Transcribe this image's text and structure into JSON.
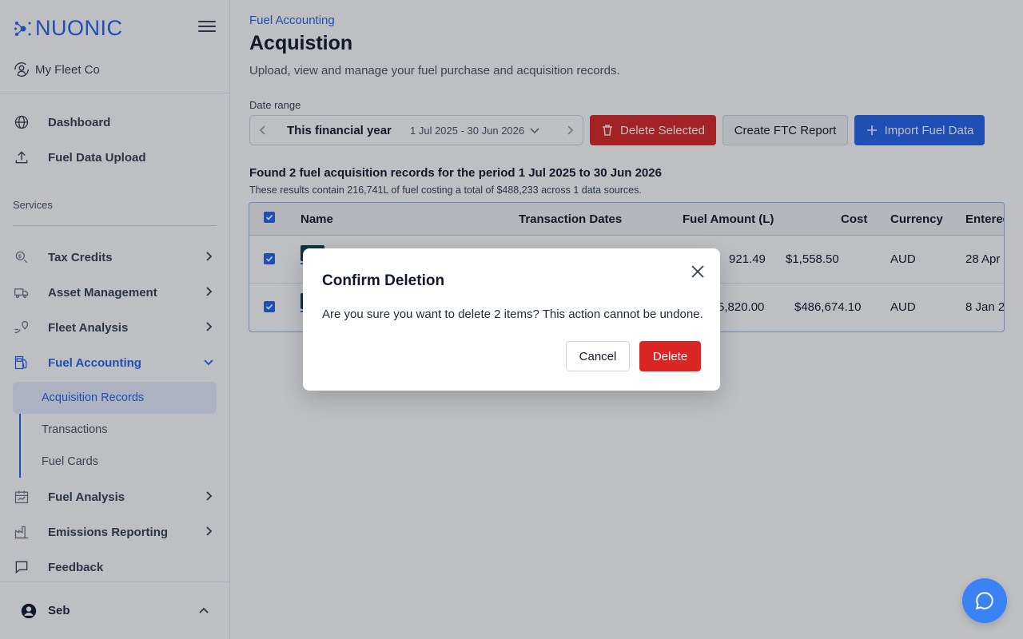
{
  "brand": {
    "name": "NUONIC",
    "color": "#2563eb"
  },
  "sidebar": {
    "org": "My Fleet Co",
    "top_items": [
      {
        "label": "Dashboard",
        "icon": "globe-icon"
      },
      {
        "label": "Fuel Data Upload",
        "icon": "upload-icon"
      }
    ],
    "section_label": "Services",
    "items": [
      {
        "label": "Tax Credits",
        "icon": "tax-credit-icon"
      },
      {
        "label": "Asset Management",
        "icon": "truck-icon"
      },
      {
        "label": "Fleet Analysis",
        "icon": "route-pin-icon"
      },
      {
        "label": "Fuel Accounting",
        "icon": "fuel-pump-icon",
        "expanded": true
      },
      {
        "label": "Fuel Analysis",
        "icon": "calendar-analysis-icon"
      },
      {
        "label": "Emissions Reporting",
        "icon": "factory-icon"
      },
      {
        "label": "Feedback",
        "icon": "chat-bubble-icon"
      }
    ],
    "sub_items": [
      {
        "label": "Acquisition Records",
        "active": true
      },
      {
        "label": "Transactions"
      },
      {
        "label": "Fuel Cards"
      }
    ],
    "user": "Seb"
  },
  "header": {
    "breadcrumb": "Fuel Accounting",
    "title": "Acquistion",
    "subtitle": "Upload, view and manage your fuel purchase and acquisition records."
  },
  "filters": {
    "date_range_label": "Date range",
    "range_name": "This financial year",
    "range_dates": "1 Jul 2025 - 30 Jun 2026"
  },
  "toolbar": {
    "delete_selected": "Delete Selected",
    "create_ftc": "Create FTC Report",
    "import": "Import Fuel Data"
  },
  "results": {
    "summary": "Found 2 fuel acquisition records for the period 1 Jul 2025 to 30 Jun 2026",
    "detail": "These results contain 216,741L of fuel costing a total of $488,233 across 1 data sources."
  },
  "table": {
    "columns": [
      "Name",
      "Transaction Dates",
      "Fuel Amount (L)",
      "Cost",
      "Currency",
      "Entered"
    ],
    "rows": [
      {
        "fuel_amount": "921.49",
        "cost": "$1,558.50",
        "currency": "AUD",
        "entered": "28 Apr"
      },
      {
        "fuel_amount": "5,820.00",
        "cost": "$486,674.10",
        "currency": "AUD",
        "entered": "8 Jan 2"
      }
    ]
  },
  "modal": {
    "title": "Confirm Deletion",
    "body": "Are you sure you want to delete 2 items? This action cannot be undone.",
    "cancel": "Cancel",
    "confirm": "Delete"
  }
}
